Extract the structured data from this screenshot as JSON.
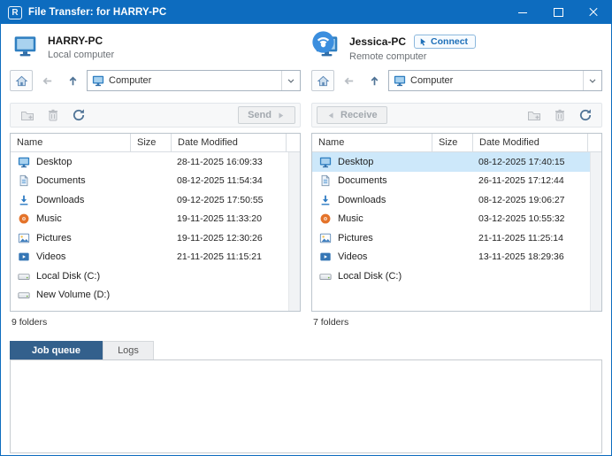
{
  "titlebar": {
    "title": "File Transfer: for HARRY-PC",
    "app_logo_letter": "R"
  },
  "colors": {
    "titlebar": "#0d6cbf",
    "accent": "#1d6fb8",
    "selection": "#cde8fa",
    "tab_active": "#33608c"
  },
  "left_panel": {
    "computer_name": "HARRY-PC",
    "computer_label": "Local computer",
    "path": "Computer",
    "send_label": "Send",
    "columns": {
      "name": "Name",
      "size": "Size",
      "date": "Date Modified"
    },
    "rows": [
      {
        "icon": "desktop",
        "name": "Desktop",
        "size": "",
        "date_modified": "28-11-2025 16:09:33"
      },
      {
        "icon": "documents",
        "name": "Documents",
        "size": "",
        "date_modified": "08-12-2025 11:54:34"
      },
      {
        "icon": "downloads",
        "name": "Downloads",
        "size": "",
        "date_modified": "09-12-2025 17:50:55"
      },
      {
        "icon": "music",
        "name": "Music",
        "size": "",
        "date_modified": "19-11-2025 11:33:20"
      },
      {
        "icon": "pictures",
        "name": "Pictures",
        "size": "",
        "date_modified": "19-11-2025 12:30:26"
      },
      {
        "icon": "videos",
        "name": "Videos",
        "size": "",
        "date_modified": "21-11-2025 11:15:21"
      },
      {
        "icon": "drive",
        "name": "Local Disk (C:)",
        "size": "",
        "date_modified": ""
      },
      {
        "icon": "drive",
        "name": "New Volume (D:)",
        "size": "",
        "date_modified": ""
      }
    ],
    "status": "9 folders"
  },
  "right_panel": {
    "computer_name": "Jessica-PC",
    "computer_label": "Remote computer",
    "connect_label": "Connect",
    "path": "Computer",
    "receive_label": "Receive",
    "columns": {
      "name": "Name",
      "size": "Size",
      "date": "Date Modified"
    },
    "rows": [
      {
        "icon": "desktop",
        "name": "Desktop",
        "size": "",
        "date_modified": "08-12-2025 17:40:15",
        "selected": true
      },
      {
        "icon": "documents",
        "name": "Documents",
        "size": "",
        "date_modified": "26-11-2025 17:12:44"
      },
      {
        "icon": "downloads",
        "name": "Downloads",
        "size": "",
        "date_modified": "08-12-2025 19:06:27"
      },
      {
        "icon": "music",
        "name": "Music",
        "size": "",
        "date_modified": "03-12-2025 10:55:32"
      },
      {
        "icon": "pictures",
        "name": "Pictures",
        "size": "",
        "date_modified": "21-11-2025 11:25:14"
      },
      {
        "icon": "videos",
        "name": "Videos",
        "size": "",
        "date_modified": "13-11-2025 18:29:36"
      },
      {
        "icon": "drive",
        "name": "Local Disk (C:)",
        "size": "",
        "date_modified": ""
      }
    ],
    "status": "7 folders"
  },
  "bottom": {
    "tabs": [
      {
        "label": "Job queue",
        "active": true
      },
      {
        "label": "Logs",
        "active": false
      }
    ]
  }
}
